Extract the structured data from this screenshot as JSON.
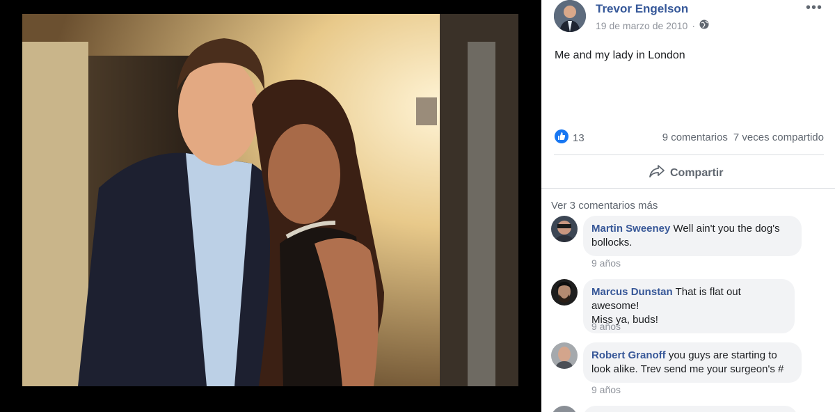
{
  "post": {
    "author": "Trevor Engelson",
    "date": "19 de marzo de 2010",
    "date_suffix": "·",
    "text": "Me and my lady in London",
    "reactions_count": "13",
    "comments_count": "9 comentarios",
    "shares_count": "7 veces compartido",
    "share_label": "Compartir",
    "more_icon": "•••"
  },
  "comments": {
    "view_more": "Ver 3 comentarios más",
    "items": [
      {
        "name": "Martin Sweeney",
        "text_line1": "Well ain't you the dog's",
        "text_line2": "bollocks.",
        "time": "9 años"
      },
      {
        "name": "Marcus Dunstan",
        "text_line1": "That is flat out awesome!",
        "text_line2": "Miss ya, buds!",
        "time": "9 años"
      },
      {
        "name": "Robert Granoff",
        "text_line1": "you guys are starting to",
        "text_line2": "look alike. Trev send me your surgeon's #",
        "time": "9 años"
      }
    ]
  },
  "colors": {
    "link": "#365899",
    "meta": "#90949c",
    "like_blue": "#1877f2"
  }
}
